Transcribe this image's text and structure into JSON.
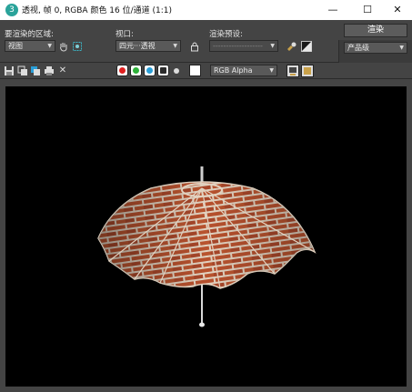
{
  "window": {
    "title": "透视, 帧 0, RGBA 颜色 16 位/通道 (1:1)",
    "app_icon_glyph": "3",
    "minimize_glyph": "—",
    "maximize_glyph": "☐",
    "close_glyph": "✕"
  },
  "controls": {
    "area_label": "要渲染的区域:",
    "area_value": "视图",
    "viewport_label": "视口:",
    "viewport_value": "四元···透视",
    "preset_label": "渲染预设:",
    "preset_value": "-------------------",
    "render_button": "渲染",
    "quality_value": "产品级"
  },
  "toolbar": {
    "channel_value": "RGB Alpha",
    "channels": [
      {
        "name": "red",
        "color": "#e02020"
      },
      {
        "name": "green",
        "color": "#2fb13a"
      },
      {
        "name": "blue",
        "color": "#2a9fd8"
      }
    ],
    "close_glyph": "✕"
  },
  "colors": {
    "background": "#444444",
    "viewport_background": "#000000",
    "brick": "#b7512e",
    "mortar": "#e2d2c0"
  }
}
